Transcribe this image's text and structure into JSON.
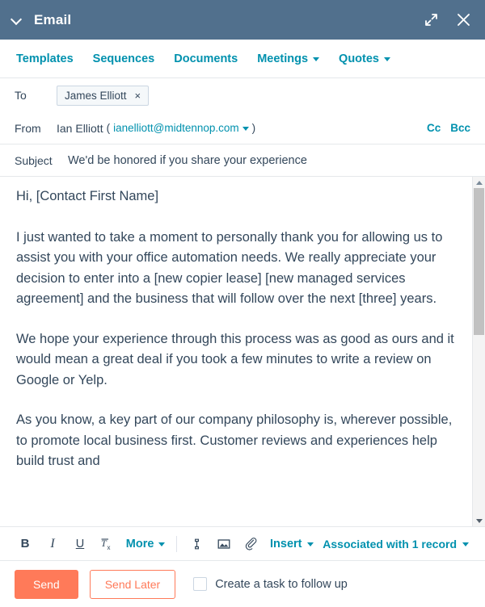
{
  "titlebar": {
    "title": "Email",
    "collapse_icon": "chevron-down-icon",
    "expand_icon": "expand-icon",
    "close_icon": "close-icon"
  },
  "tabs": [
    {
      "label": "Templates",
      "has_caret": false
    },
    {
      "label": "Sequences",
      "has_caret": false
    },
    {
      "label": "Documents",
      "has_caret": false
    },
    {
      "label": "Meetings",
      "has_caret": true
    },
    {
      "label": "Quotes",
      "has_caret": true
    }
  ],
  "fields": {
    "to_label": "To",
    "to_recipient": "James Elliott",
    "to_chip_remove": "×",
    "from_label": "From",
    "from_name": "Ian Elliott",
    "from_paren_open": "(",
    "from_email": "ianelliott@midtennop.com",
    "from_paren_close": ")",
    "cc_label": "Cc",
    "bcc_label": "Bcc",
    "subject_label": "Subject",
    "subject_value": "We'd be honored if you share your experience"
  },
  "body": {
    "paragraphs": [
      "Hi, [Contact First Name]",
      "I just wanted to take a moment to personally thank you for allowing us to assist you with your office automation needs. We really appreciate your decision to enter into a [new copier lease] [new managed services agreement] and the business that will follow over the next [three] years.",
      "We hope your experience through this process was as good as ours and it would mean a great deal if you took a few minutes to write a review on Google or Yelp.",
      "As you know, a key part of our company philosophy is, wherever possible, to promote local business first. Customer reviews and experiences help build trust and"
    ],
    "scrollbar": {
      "up_arrow": "scroll-up-arrow",
      "down_arrow": "scroll-down-arrow",
      "thumb_position_percent": 0,
      "thumb_size_percent": 45
    }
  },
  "toolbar": {
    "bold": "B",
    "italic": "I",
    "underline": "U",
    "clear_format": "Tx",
    "more_label": "More",
    "link_icon": "link-icon",
    "image_icon": "image-icon",
    "attachment_icon": "paperclip-icon",
    "insert_label": "Insert",
    "associated_label": "Associated with 1 record"
  },
  "actions": {
    "send_label": "Send",
    "send_later_label": "Send Later",
    "followup_label": "Create a task to follow up",
    "followup_checked": false
  },
  "colors": {
    "titlebar_bg": "#51708d",
    "link_teal": "#0091ae",
    "text_dark": "#33475b",
    "accent_orange": "#ff7a59",
    "border": "#e5e8eb"
  }
}
